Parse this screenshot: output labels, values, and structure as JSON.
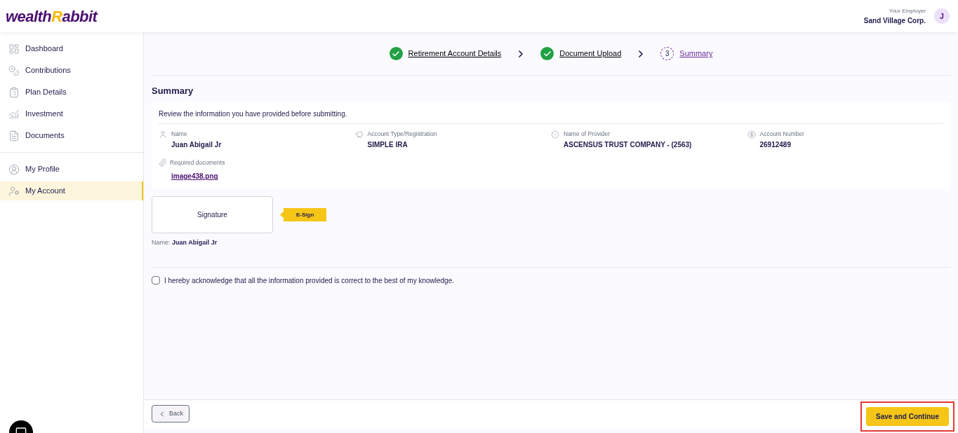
{
  "logo": {
    "first": "wealth",
    "accent": "R",
    "rest": "abbit"
  },
  "employer": {
    "label": "Your Employer",
    "name": "Sand Village Corp."
  },
  "avatar": {
    "initial": "J"
  },
  "sidebar": {
    "main": [
      {
        "label": "Dashboard",
        "selected": false
      },
      {
        "label": "Contributions",
        "selected": false
      },
      {
        "label": "Plan Details",
        "selected": false
      },
      {
        "label": "Investment",
        "selected": false
      },
      {
        "label": "Documents",
        "selected": false
      }
    ],
    "secondary": [
      {
        "label": "My Profile",
        "selected": false
      },
      {
        "label": "My Account",
        "selected": true
      }
    ]
  },
  "steps": [
    {
      "label": "Retirement Account Details",
      "done": true
    },
    {
      "label": "Document Upload",
      "done": true
    },
    {
      "label": "Summary",
      "number": "3",
      "done": false
    }
  ],
  "summary": {
    "title": "Summary",
    "intro": "Review the information you have provided before submitting.",
    "fields": [
      {
        "label": "Name",
        "value": "Juan Abigail Jr"
      },
      {
        "label": "Account Type/Registration",
        "value": "SIMPLE IRA"
      },
      {
        "label": "Name of Provider",
        "value": "ASCENSUS TRUST COMPANY - (2563)"
      },
      {
        "label": "Account Number",
        "value": "26912489"
      }
    ],
    "documents": {
      "label": "Required documents",
      "files": [
        "image438.png"
      ]
    }
  },
  "signature": {
    "box": "Signature",
    "tag": "E-Sign",
    "name_label": "Name:",
    "name": "Juan Abigail Jr"
  },
  "acknowledge": {
    "text": "I hereby acknowledge that all the information provided is correct to the best of my knowledge.",
    "checked": false
  },
  "footer": {
    "back": "Back",
    "save": "Save and Continue"
  }
}
